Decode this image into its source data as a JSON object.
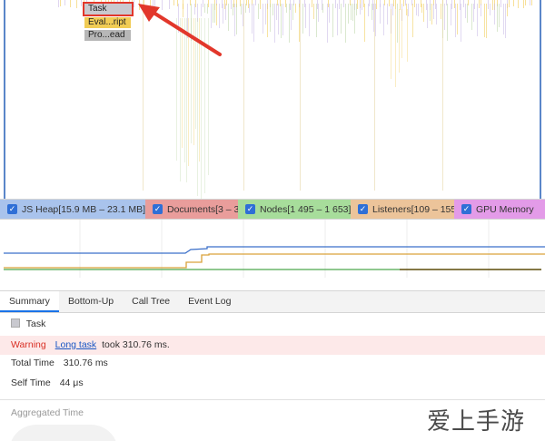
{
  "flame": {
    "blocks": {
      "task": "Task",
      "evaluate": "Eval...ript",
      "process": "Pro...ead"
    },
    "highlight_color": "#e2372b"
  },
  "counters": {
    "js_heap": "JS Heap[15.9 MB – 23.1 MB]",
    "documents": "Documents[3 – 3]",
    "nodes": "Nodes[1 495 – 1 653]",
    "listeners": "Listeners[109 – 155]",
    "gpu_memory": "GPU Memory",
    "check_glyph": "✓"
  },
  "tabs": {
    "summary": "Summary",
    "bottom_up": "Bottom-Up",
    "call_tree": "Call Tree",
    "event_log": "Event Log"
  },
  "summary": {
    "task_label": "Task",
    "warning_label": "Warning",
    "long_task_link": "Long task",
    "warning_text": "took 310.76 ms.",
    "total_time_label": "Total Time",
    "total_time_value": "310.76 ms",
    "self_time_label": "Self Time",
    "self_time_value": "44 μs",
    "aggregated_time_label": "Aggregated Time"
  },
  "watermark": "爱上手游网",
  "colors": {
    "heap": "#a9c3ec",
    "documents": "#e99d9b",
    "nodes": "#a7dd9b",
    "listeners": "#ecc49a",
    "gpu": "#e39be8",
    "accent": "#1a73e8",
    "warning": "#d93025"
  }
}
